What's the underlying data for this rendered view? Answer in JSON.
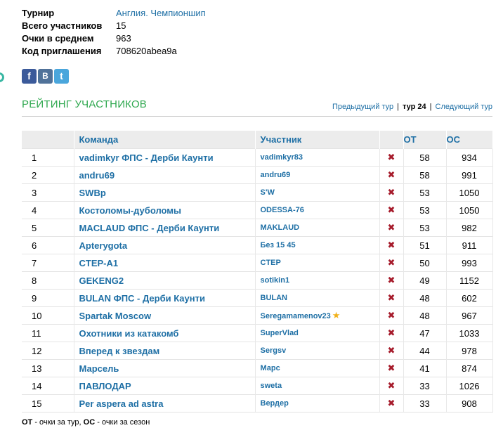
{
  "info": [
    {
      "label": "Турнир",
      "value": "Англия. Чемпионшип",
      "link": true
    },
    {
      "label": "Всего участников",
      "value": "15",
      "link": false
    },
    {
      "label": "Очки в среднем",
      "value": "963",
      "link": false
    },
    {
      "label": "Код приглашения",
      "value": "708620abea9a",
      "link": false
    }
  ],
  "social": {
    "facebook": "f",
    "vkontakte": "B",
    "twitter": "t"
  },
  "section_title": "РЕЙТИНГ УЧАСТНИКОВ",
  "tour_nav": {
    "prev": "Предыдущий тур",
    "sep1": "|",
    "current": "тур 24",
    "sep2": "|",
    "next": "Следующий тур"
  },
  "table": {
    "headers": {
      "team": "Команда",
      "participant": "Участник",
      "ot": "ОТ",
      "os": "ОС"
    },
    "remove_glyph": "✖",
    "rows": [
      {
        "num": "1",
        "team": "vadimkyr ФПС - Дерби Каунти",
        "participant": "vadimkyr83",
        "star": false,
        "ot": "58",
        "os": "934"
      },
      {
        "num": "2",
        "team": "andru69",
        "participant": "andru69",
        "star": false,
        "ot": "58",
        "os": "991"
      },
      {
        "num": "3",
        "team": "SWBp",
        "participant": "S'W",
        "star": false,
        "ot": "53",
        "os": "1050"
      },
      {
        "num": "4",
        "team": "Костоломы-дуболомы",
        "participant": "ODESSA-76",
        "star": false,
        "ot": "53",
        "os": "1050"
      },
      {
        "num": "5",
        "team": "MACLAUD ФПС - Дерби Каунти",
        "participant": "MAKLAUD",
        "star": false,
        "ot": "53",
        "os": "982"
      },
      {
        "num": "6",
        "team": "Apterygota",
        "participant": "Без 15 45",
        "star": false,
        "ot": "51",
        "os": "911"
      },
      {
        "num": "7",
        "team": "CTEP-A1",
        "participant": "CTEP",
        "star": false,
        "ot": "50",
        "os": "993"
      },
      {
        "num": "8",
        "team": "GEKENG2",
        "participant": "sotikin1",
        "star": false,
        "ot": "49",
        "os": "1152"
      },
      {
        "num": "9",
        "team": "BULAN ФПС - Дерби Каунти",
        "participant": "BULAN",
        "star": false,
        "ot": "48",
        "os": "602"
      },
      {
        "num": "10",
        "team": "Spartak Moscow",
        "participant": "Seregamamenov23",
        "star": true,
        "ot": "48",
        "os": "967"
      },
      {
        "num": "11",
        "team": "Охотники из катакомб",
        "participant": "SuperVlad",
        "star": false,
        "ot": "47",
        "os": "1033"
      },
      {
        "num": "12",
        "team": "Вперед к звездам",
        "participant": "Sergsv",
        "star": false,
        "ot": "44",
        "os": "978"
      },
      {
        "num": "13",
        "team": "Марсель",
        "participant": "Марс",
        "star": false,
        "ot": "41",
        "os": "874"
      },
      {
        "num": "14",
        "team": "ПАВЛОДАР",
        "participant": "sweta",
        "star": false,
        "ot": "33",
        "os": "1026"
      },
      {
        "num": "15",
        "team": "Per aspera ad astra",
        "participant": "Вердер",
        "star": false,
        "ot": "33",
        "os": "908"
      }
    ]
  },
  "legend": {
    "ot_abbr": "ОТ",
    "ot_text": " - очки за тур, ",
    "os_abbr": "ОС",
    "os_text": " - очки за сезон"
  },
  "colors": {
    "link": "#1e6fa5",
    "section_title": "#2fa84f",
    "remove": "#a61b2b",
    "star": "#f1b11a"
  }
}
